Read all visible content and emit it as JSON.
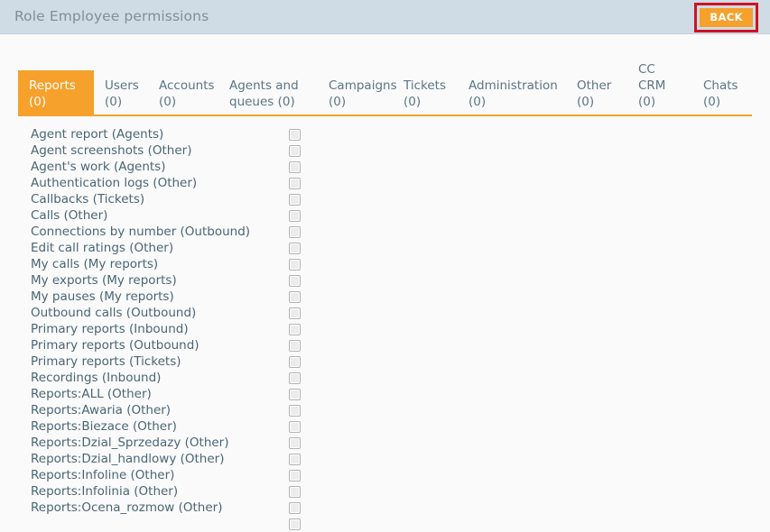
{
  "header": {
    "title": "Role Employee permissions",
    "back_label": "BACK",
    "accent_orange": "#f5a12c",
    "highlight_red": "#cf1225",
    "band_color": "#cfdce5"
  },
  "tabs": [
    {
      "label": "Reports (0)",
      "active": true
    },
    {
      "label": "Users (0)",
      "active": false
    },
    {
      "label": "Accounts (0)",
      "active": false
    },
    {
      "label": "Agents and queues (0)",
      "active": false
    },
    {
      "label": "Campaigns (0)",
      "active": false
    },
    {
      "label": "Tickets (0)",
      "active": false
    },
    {
      "label": "Administration (0)",
      "active": false
    },
    {
      "label": "Other (0)",
      "active": false
    },
    {
      "label": "CC CRM (0)",
      "active": false
    },
    {
      "label": "Chats (0)",
      "active": false
    }
  ],
  "permissions": [
    {
      "label": "Agent report (Agents)",
      "checked": false
    },
    {
      "label": "Agent screenshots (Other)",
      "checked": false
    },
    {
      "label": "Agent's work (Agents)",
      "checked": false
    },
    {
      "label": "Authentication logs (Other)",
      "checked": false
    },
    {
      "label": "Callbacks (Tickets)",
      "checked": false
    },
    {
      "label": "Calls (Other)",
      "checked": false
    },
    {
      "label": "Connections by number (Outbound)",
      "checked": false
    },
    {
      "label": "Edit call ratings (Other)",
      "checked": false
    },
    {
      "label": "My calls (My reports)",
      "checked": false
    },
    {
      "label": "My exports (My reports)",
      "checked": false
    },
    {
      "label": "My pauses (My reports)",
      "checked": false
    },
    {
      "label": "Outbound calls (Outbound)",
      "checked": false
    },
    {
      "label": "Primary reports (Inbound)",
      "checked": false
    },
    {
      "label": "Primary reports (Outbound)",
      "checked": false
    },
    {
      "label": "Primary reports (Tickets)",
      "checked": false
    },
    {
      "label": "Recordings (Inbound)",
      "checked": false
    },
    {
      "label": "Reports:ALL (Other)",
      "checked": false
    },
    {
      "label": "Reports:Awaria (Other)",
      "checked": false
    },
    {
      "label": "Reports:Biezace (Other)",
      "checked": false
    },
    {
      "label": "Reports:Dzial_Sprzedazy (Other)",
      "checked": false
    },
    {
      "label": "Reports:Dzial_handlowy (Other)",
      "checked": false
    },
    {
      "label": "Reports:Infoline (Other)",
      "checked": false
    },
    {
      "label": "Reports:Infolinia (Other)",
      "checked": false
    },
    {
      "label": "Reports:Ocena_rozmow (Other)",
      "checked": false
    },
    {
      "label": "",
      "checked": false
    }
  ]
}
